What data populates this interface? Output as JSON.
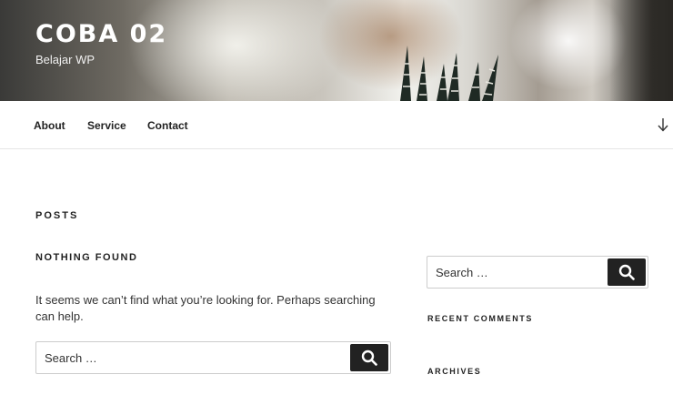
{
  "site": {
    "title": "COBA 02",
    "description": "Belajar WP"
  },
  "nav": {
    "items": [
      {
        "label": "About"
      },
      {
        "label": "Service"
      },
      {
        "label": "Contact"
      }
    ],
    "scroll_icon": "arrow-down-icon"
  },
  "main": {
    "posts_heading": "POSTS",
    "nothing_found": "NOTHING FOUND",
    "message": "It seems we can’t find what you’re looking for. Perhaps searching can help.",
    "search": {
      "placeholder": "Search …",
      "button_icon": "search-icon"
    }
  },
  "sidebar": {
    "search": {
      "placeholder": "Search …",
      "button_icon": "search-icon"
    },
    "recent_comments_title": "RECENT COMMENTS",
    "archives_title": "ARCHIVES"
  },
  "colors": {
    "button": "#222222",
    "text": "#222222",
    "border": "#cccccc"
  }
}
